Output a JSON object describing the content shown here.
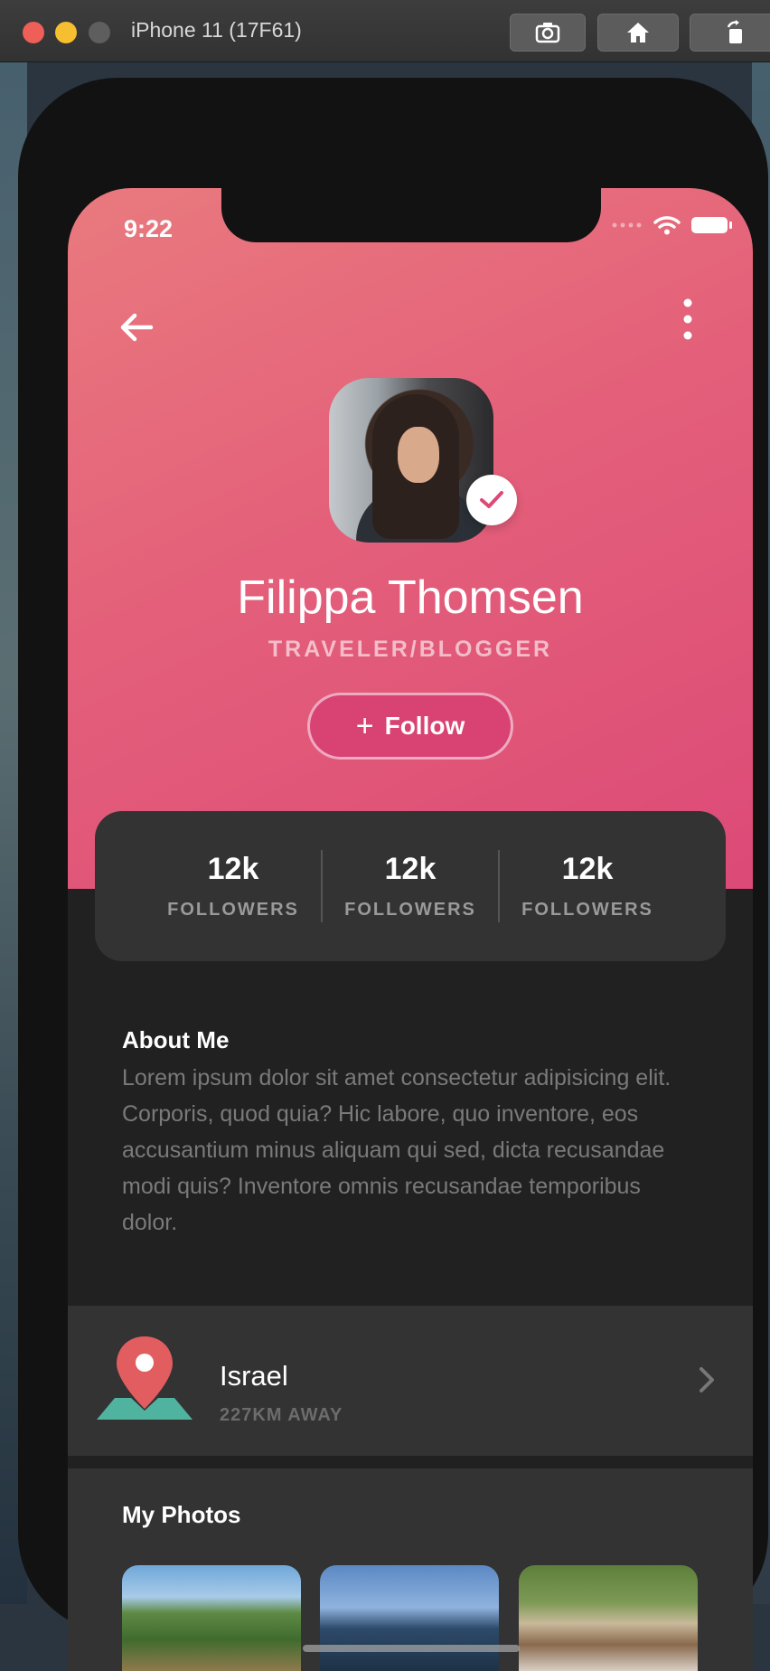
{
  "window": {
    "title": "iPhone 11 (17F61)",
    "buttons": [
      "screenshot-icon",
      "home-icon",
      "rotate-icon"
    ]
  },
  "status_bar": {
    "time": "9:22"
  },
  "profile": {
    "name": "Filippa Thomsen",
    "role": "TRAVELER/BLOGGER",
    "follow_label": "Follow"
  },
  "stats": [
    {
      "value": "12k",
      "label": "FOLLOWERS"
    },
    {
      "value": "12k",
      "label": "FOLLOWERS"
    },
    {
      "value": "12k",
      "label": "FOLLOWERS"
    }
  ],
  "about": {
    "title": "About Me",
    "text": "Lorem ipsum dolor sit amet consectetur adipisicing elit. Corporis, quod quia? Hic labore, quo inventore, eos accusantium minus aliquam qui sed, dicta recusandae modi quis? Inventore omnis recusandae temporibus dolor."
  },
  "location": {
    "name": "Israel",
    "distance": "227KM AWAY"
  },
  "photos": {
    "title": "My Photos"
  },
  "colors": {
    "hero_start": "#e97a7e",
    "hero_end": "#dc4a77",
    "background": "#212121",
    "card": "#333333",
    "pin": "#e25d60",
    "map": "#4fb3a0"
  }
}
